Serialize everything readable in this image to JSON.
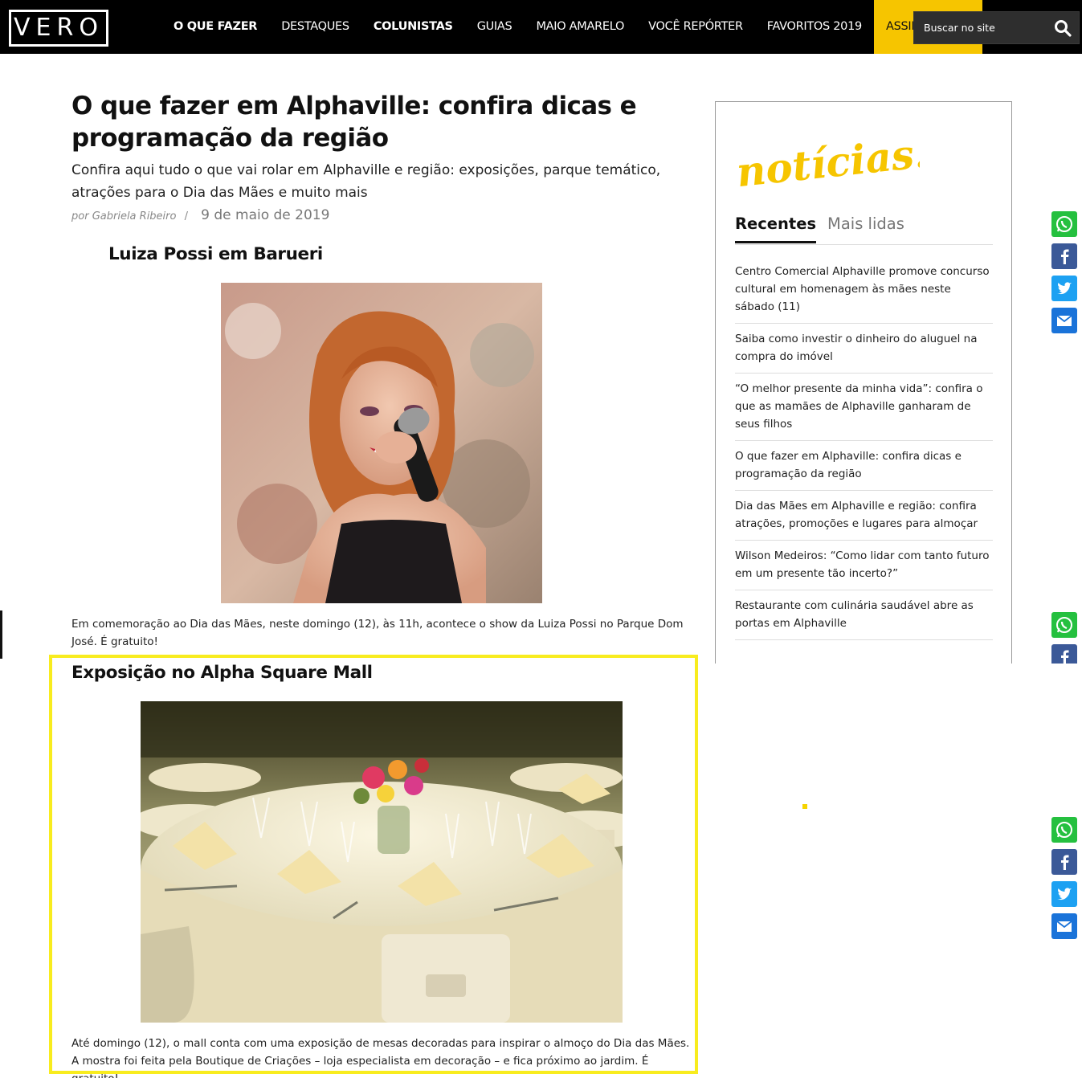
{
  "header": {
    "logo": "VERO",
    "nav": [
      {
        "label": "O QUE FAZER",
        "bold": true
      },
      {
        "label": "DESTAQUES",
        "bold": false
      },
      {
        "label": "COLUNISTAS",
        "bold": true
      },
      {
        "label": "GUIAS",
        "bold": false
      },
      {
        "label": "MAIO AMARELO",
        "bold": false
      },
      {
        "label": "VOCÊ REPÓRTER",
        "bold": false
      },
      {
        "label": "FAVORITOS 2019",
        "bold": false
      }
    ],
    "assine_label": "ASSINE O",
    "search_placeholder": "Buscar no site",
    "accent_color": "#f6c500"
  },
  "article": {
    "title": "O que fazer em Alphaville: confira dicas e programação da região",
    "subtitle": "Confira aqui tudo o que vai rolar em Alphaville e região: exposições, parque temático, atrações para o Dia das Mães e muito mais",
    "by_prefix": "por",
    "author": "Gabriela Ribeiro",
    "separator": "/",
    "date": "9 de maio de 2019",
    "sections": [
      {
        "heading": "Luiza Possi em Barueri",
        "text": "Em comemoração ao Dia das Mães, neste domingo (12), às 11h, acontece o show da Luiza Possi no Parque Dom José. É gratuito!"
      },
      {
        "heading": "Exposição no Alpha Square Mall",
        "text": "Até domingo (12), o mall conta com uma exposição de mesas decoradas para inspirar o almoço do Dia das Mães. A mostra foi feita pela Boutique de Criações – loja especialista em decoração – e fica próximo ao jardim. É gratuito!"
      }
    ]
  },
  "sidebar": {
    "logo_text": "notícias!",
    "tabs": [
      "Recentes",
      "Mais lidas"
    ],
    "news": [
      "Centro Comercial Alphaville promove concurso cultural em homenagem às mães neste sábado (11)",
      "Saiba como investir o dinheiro do aluguel na compra do imóvel",
      "“O melhor presente da minha vida”: confira o que as mamães de Alphaville ganharam de seus filhos",
      "O que fazer em Alphaville: confira dicas e programação da região",
      "Dia das Mães em Alphaville e região: confira atrações, promoções e lugares para almoçar",
      "Wilson Medeiros: “Como lidar com tanto futuro em um presente tão incerto?”",
      "Restaurante com culinária saudável abre as portas em Alphaville"
    ]
  },
  "share": {
    "icons": [
      "whatsapp-icon",
      "facebook-icon",
      "twitter-icon",
      "email-icon"
    ]
  }
}
